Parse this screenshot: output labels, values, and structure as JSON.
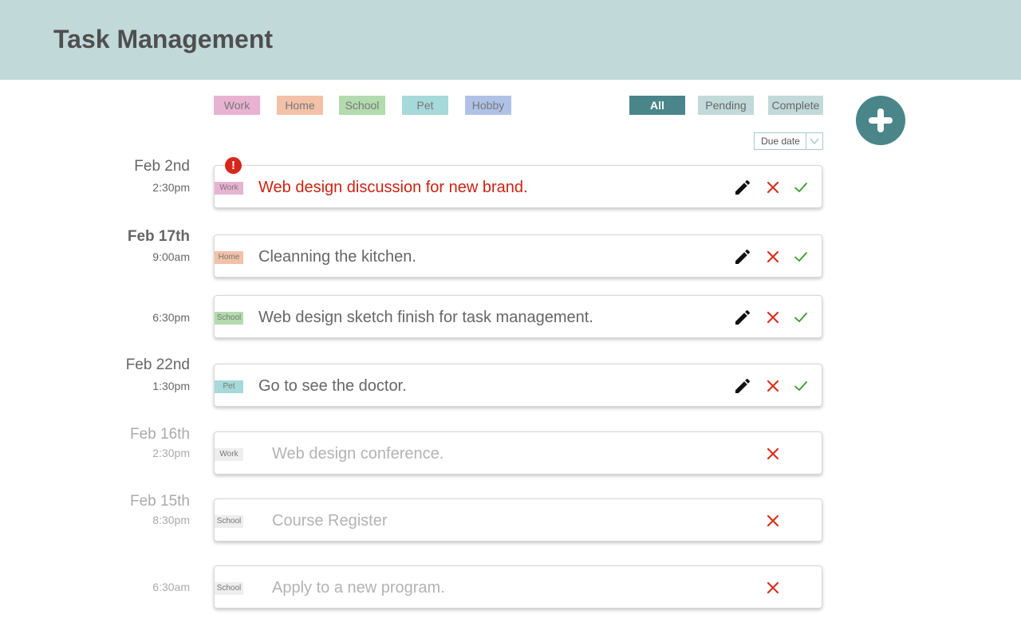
{
  "header": {
    "title": "Task Management"
  },
  "categories": [
    {
      "label": "Work",
      "color": "#e8b3d2"
    },
    {
      "label": "Home",
      "color": "#f2c1a8"
    },
    {
      "label": "School",
      "color": "#b3dbae"
    },
    {
      "label": "Pet",
      "color": "#a6d9d9"
    },
    {
      "label": "Hobby",
      "color": "#b0c1e8"
    }
  ],
  "filters": [
    {
      "label": "All",
      "active": true
    },
    {
      "label": "Pending",
      "active": false
    },
    {
      "label": "Complete",
      "active": false
    }
  ],
  "sort": {
    "label": "Due date"
  },
  "alert_glyph": "!",
  "tasks": [
    {
      "date": "Feb 2nd",
      "time": "2:30pm",
      "tag": "Work",
      "text": "Web design discussion for new brand.",
      "status": "urgent"
    },
    {
      "date": "Feb 17th",
      "time": "9:00am",
      "tag": "Home",
      "text": "Cleanning the kitchen.",
      "status": "pending"
    },
    {
      "date": "",
      "time": "6:30pm",
      "tag": "School",
      "text": "Web design sketch finish for task management.",
      "status": "pending"
    },
    {
      "date": "Feb 22nd",
      "time": "1:30pm",
      "tag": "Pet",
      "text": "Go to see the doctor.",
      "status": "pending"
    },
    {
      "date": "Feb 16th",
      "time": "2:30pm",
      "tag": "Work",
      "text": "Web design conference.",
      "status": "complete"
    },
    {
      "date": "Feb 15th",
      "time": "8:30pm",
      "tag": "School",
      "text": "Course Register",
      "status": "complete"
    },
    {
      "date": "",
      "time": "6:30am",
      "tag": "School",
      "text": "Apply to a new program.",
      "status": "complete"
    }
  ],
  "colors": {
    "header_bg": "#c2d9da",
    "accent": "#4a8589",
    "urgent_text": "#cc2211",
    "delete_icon": "#d9301e",
    "check_icon": "#3a9a2a",
    "completed_tag_bg": "#eeeeee"
  },
  "icons": {
    "edit": "pencil-icon",
    "delete": "close-icon",
    "complete": "check-icon",
    "add": "plus-icon",
    "sort": "chevron-down-icon",
    "alert": "exclamation-icon"
  }
}
